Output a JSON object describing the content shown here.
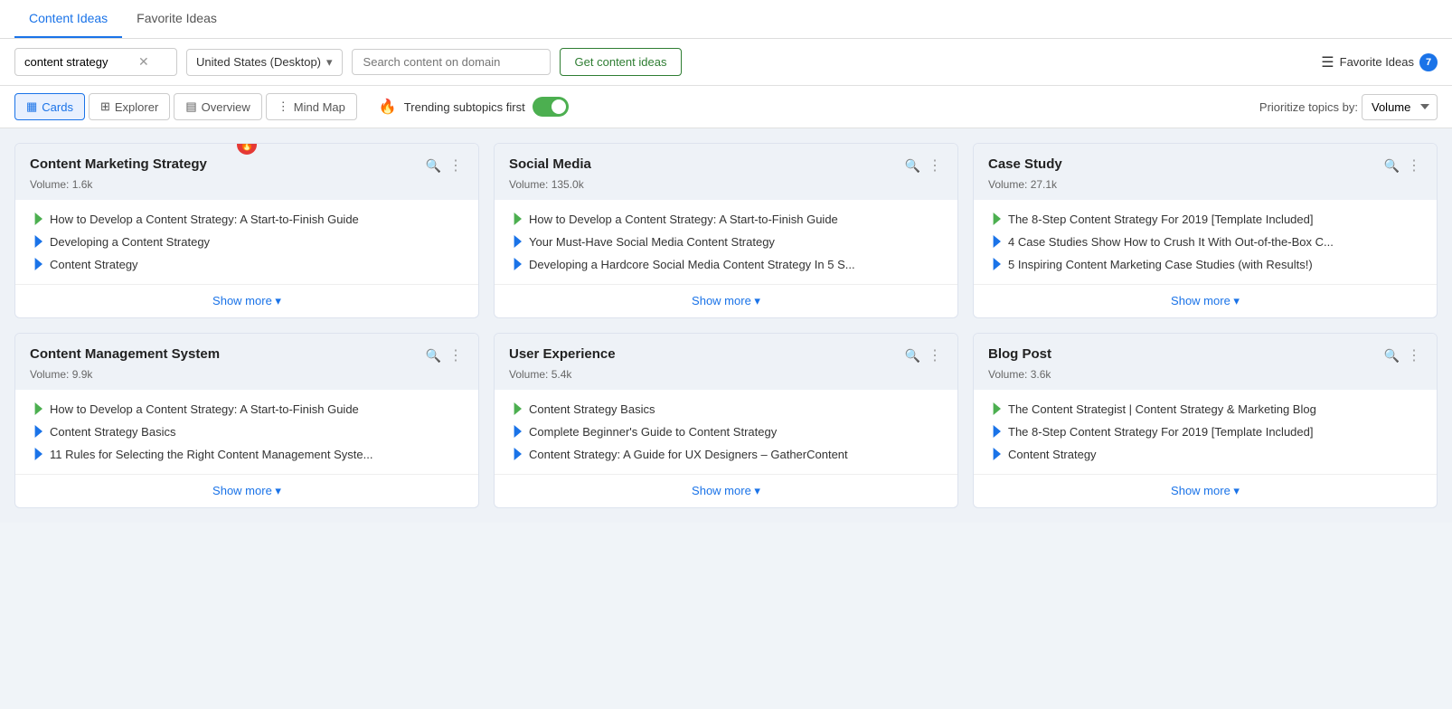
{
  "tabs": {
    "active": "Content Ideas",
    "items": [
      "Content Ideas",
      "Favorite Ideas"
    ]
  },
  "toolbar": {
    "keyword_value": "content strategy",
    "location_value": "United States (Desktop)",
    "domain_placeholder": "Search content on domain",
    "get_ideas_label": "Get content ideas",
    "fav_ideas_label": "Favorite Ideas",
    "fav_count": "7"
  },
  "view_toolbar": {
    "views": [
      {
        "id": "cards",
        "label": "Cards",
        "active": true
      },
      {
        "id": "explorer",
        "label": "Explorer",
        "active": false
      },
      {
        "id": "overview",
        "label": "Overview",
        "active": false
      },
      {
        "id": "mind-map",
        "label": "Mind Map",
        "active": false
      }
    ],
    "trending_label": "Trending subtopics first",
    "trending_on": true,
    "prioritize_label": "Prioritize topics by:",
    "volume_value": "Volume"
  },
  "cards": [
    {
      "id": "card-1",
      "title": "Content Marketing Strategy",
      "volume": "Volume: 1.6k",
      "trending": true,
      "items": [
        {
          "type": "green",
          "text": "How to Develop a Content Strategy: A Start-to-Finish Guide"
        },
        {
          "type": "blue",
          "text": "Developing a Content Strategy"
        },
        {
          "type": "blue",
          "text": "Content Strategy"
        }
      ],
      "show_more": "Show more"
    },
    {
      "id": "card-2",
      "title": "Social Media",
      "volume": "Volume: 135.0k",
      "trending": false,
      "items": [
        {
          "type": "green",
          "text": "How to Develop a Content Strategy: A Start-to-Finish Guide"
        },
        {
          "type": "blue",
          "text": "Your Must-Have Social Media Content Strategy"
        },
        {
          "type": "blue",
          "text": "Developing a Hardcore Social Media Content Strategy In 5 S..."
        }
      ],
      "show_more": "Show more"
    },
    {
      "id": "card-3",
      "title": "Case Study",
      "volume": "Volume: 27.1k",
      "trending": false,
      "items": [
        {
          "type": "green",
          "text": "The 8-Step Content Strategy For 2019 [Template Included]"
        },
        {
          "type": "blue",
          "text": "4 Case Studies Show How to Crush It With Out-of-the-Box C..."
        },
        {
          "type": "blue",
          "text": "5 Inspiring Content Marketing Case Studies (with Results!)"
        }
      ],
      "show_more": "Show more"
    },
    {
      "id": "card-4",
      "title": "Content Management System",
      "volume": "Volume: 9.9k",
      "trending": false,
      "items": [
        {
          "type": "green",
          "text": "How to Develop a Content Strategy: A Start-to-Finish Guide"
        },
        {
          "type": "blue",
          "text": "Content Strategy Basics"
        },
        {
          "type": "blue",
          "text": "11 Rules for Selecting the Right Content Management Syste..."
        }
      ],
      "show_more": "Show more"
    },
    {
      "id": "card-5",
      "title": "User Experience",
      "volume": "Volume: 5.4k",
      "trending": false,
      "items": [
        {
          "type": "green",
          "text": "Content Strategy Basics"
        },
        {
          "type": "blue",
          "text": "Complete Beginner's Guide to Content Strategy"
        },
        {
          "type": "blue",
          "text": "Content Strategy: A Guide for UX Designers – GatherContent"
        }
      ],
      "show_more": "Show more"
    },
    {
      "id": "card-6",
      "title": "Blog Post",
      "volume": "Volume: 3.6k",
      "trending": false,
      "items": [
        {
          "type": "green",
          "text": "The Content Strategist | Content Strategy & Marketing Blog"
        },
        {
          "type": "blue",
          "text": "The 8-Step Content Strategy For 2019 [Template Included]"
        },
        {
          "type": "blue",
          "text": "Content Strategy"
        }
      ],
      "show_more": "Show more"
    }
  ]
}
